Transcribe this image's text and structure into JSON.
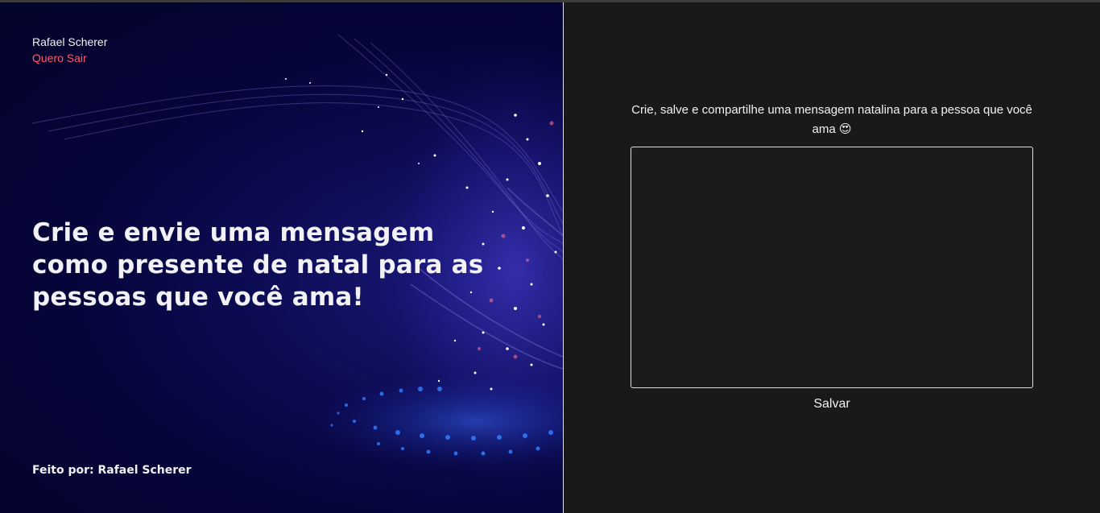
{
  "user": {
    "name": "Rafael Scherer",
    "logout_label": "Quero Sair"
  },
  "hero": {
    "title": "Crie e envie uma mensagem como presente de natal para as pessoas que você ama!"
  },
  "footer": {
    "credit": "Feito por: Rafael Scherer"
  },
  "editor": {
    "instruction": "Crie, salve e compartilhe uma mensagem natalina para a pessoa que você ama",
    "emoji": "😍",
    "message_value": "",
    "save_label": "Salvar"
  },
  "colors": {
    "left_bg": "#06053a",
    "right_bg": "#191919",
    "accent_logout": "#ff5a6a",
    "text": "#f2f2f2"
  }
}
